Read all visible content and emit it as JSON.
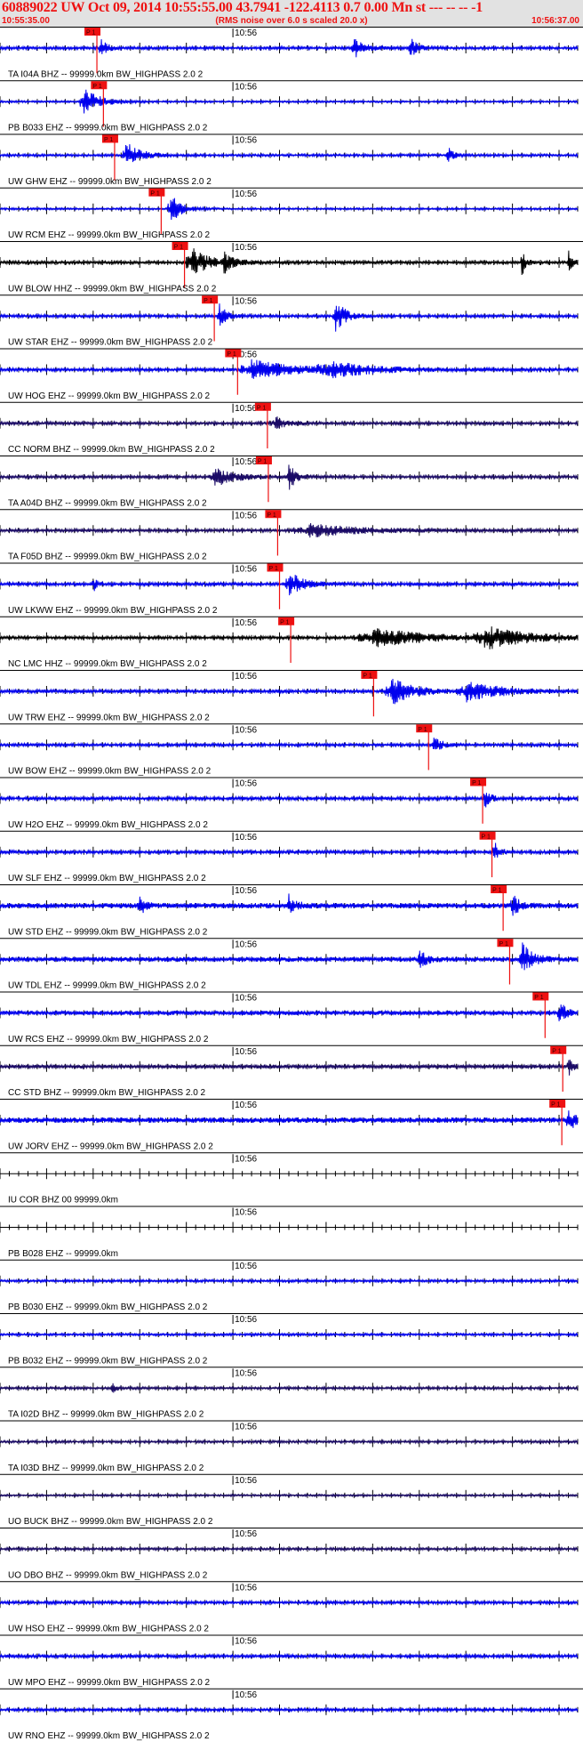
{
  "header": {
    "title": "60889022 UW Oct 09, 2014 10:55:55.00   43.7941 -122.4113  0.7 0.00 Mn st --- -- --   -1",
    "subtitle": "(RMS noise over 6.0 s scaled 20.0 x)",
    "start_time": "10:55:35.00",
    "end_time": "10:56:37.00"
  },
  "colors": {
    "header_bg": "#e2e2e2",
    "header_text": "#ee1111",
    "pick": "#ee1111",
    "blue": "#0000ee",
    "navy": "#1a0a66",
    "black": "#000000"
  },
  "chart_data": {
    "type": "seismogram",
    "x_range_seconds": [
      0,
      62
    ],
    "tick_label": "10:56",
    "pick_label": "P 1",
    "traces": [
      {
        "label": "TA I04A BHZ -- 99999.0km BW_HIGHPASS  2.0  2",
        "color": "blue",
        "noise": 0.3,
        "pick": 10.4,
        "bursts": [
          [
            10.8,
            8.0,
            0.8
          ],
          [
            38,
            6.0,
            1.5
          ],
          [
            44,
            7.0,
            1.0
          ]
        ]
      },
      {
        "label": "PB B033 EHZ -- 99999.0km BW_HIGHPASS  2.0  2",
        "color": "blue",
        "noise": 0.2,
        "pick": 11.1,
        "bursts": [
          [
            9,
            9.0,
            2.2
          ]
        ]
      },
      {
        "label": "UW GHW EHZ -- 99999.0km BW_HIGHPASS  2.0  2",
        "color": "blue",
        "noise": 0.25,
        "pick": 12.3,
        "bursts": [
          [
            13.5,
            9.0,
            2.0
          ],
          [
            48,
            6.0,
            0.8
          ]
        ]
      },
      {
        "label": "UW RCM EHZ -- 99999.0km BW_HIGHPASS  2.0  2",
        "color": "blue",
        "noise": 0.2,
        "pick": 17.3,
        "bursts": [
          [
            18.3,
            9.5,
            1.5
          ]
        ]
      },
      {
        "label": "UW BLOW HHZ -- 99999.0km BW_HIGHPASS  2.0  2",
        "color": "black",
        "noise": 0.3,
        "pick": 19.8,
        "bursts": [
          [
            20.5,
            9.5,
            2.5
          ],
          [
            24,
            6.0,
            1.5
          ],
          [
            56,
            10.0,
            0.5
          ],
          [
            61,
            8.0,
            0.5
          ]
        ]
      },
      {
        "label": "UW STAR EHZ -- 99999.0km BW_HIGHPASS  2.0  2",
        "color": "blue",
        "noise": 0.3,
        "pick": 23.0,
        "bursts": [
          [
            23.5,
            8.0,
            1.0
          ],
          [
            36,
            10.0,
            1.5
          ]
        ]
      },
      {
        "label": "UW HOG EHZ -- 99999.0km BW_HIGHPASS  2.0  2",
        "color": "blue",
        "noise": 0.35,
        "pick": 25.5,
        "bursts": [
          [
            27,
            6.0,
            6.0
          ],
          [
            35,
            5.0,
            6.0
          ]
        ]
      },
      {
        "label": "CC NORM BHZ -- 99999.0km BW_HIGHPASS  2.0  2",
        "color": "navy",
        "noise": 0.3,
        "pick": 28.7,
        "bursts": [
          [
            29.5,
            4.0,
            2.0
          ]
        ]
      },
      {
        "label": "TA A04D BHZ -- 99999.0km BW_HIGHPASS  2.0  2",
        "color": "navy",
        "noise": 0.3,
        "pick": 28.8,
        "bursts": [
          [
            23,
            6.0,
            3.0
          ],
          [
            31,
            9.0,
            1.0
          ]
        ]
      },
      {
        "label": "TA F05D BHZ -- 99999.0km BW_HIGHPASS  2.0  2",
        "color": "navy",
        "noise": 0.3,
        "pick": 29.8,
        "bursts": [
          [
            33,
            4.0,
            8.0
          ]
        ]
      },
      {
        "label": "UW LKWW EHZ -- 99999.0km BW_HIGHPASS  2.0  2",
        "color": "blue",
        "noise": 0.35,
        "pick": 30.0,
        "bursts": [
          [
            31,
            8.0,
            2.0
          ],
          [
            10,
            5.0,
            0.5
          ]
        ]
      },
      {
        "label": "NC LMC HHZ -- 99999.0km BW_HIGHPASS  2.0  2",
        "color": "black",
        "noise": 0.3,
        "pick": 31.2,
        "bursts": [
          [
            40,
            6.0,
            8.0
          ],
          [
            52,
            7.0,
            6.0
          ]
        ]
      },
      {
        "label": "UW TRW EHZ -- 99999.0km BW_HIGHPASS  2.0  2",
        "color": "blue",
        "noise": 0.35,
        "pick": 40.1,
        "bursts": [
          [
            42,
            9.5,
            3.0
          ],
          [
            50,
            6.0,
            5.0
          ]
        ]
      },
      {
        "label": "UW BOW EHZ -- 99999.0km BW_HIGHPASS  2.0  2",
        "color": "blue",
        "noise": 0.3,
        "pick": 46.0,
        "bursts": [
          [
            46.5,
            7.0,
            1.0
          ]
        ]
      },
      {
        "label": "UW H2O EHZ -- 99999.0km BW_HIGHPASS  2.0  2",
        "color": "blue",
        "noise": 0.35,
        "pick": 51.8,
        "bursts": [
          [
            52,
            7.0,
            0.8
          ]
        ]
      },
      {
        "label": "UW SLF EHZ -- 99999.0km BW_HIGHPASS  2.0  2",
        "color": "blue",
        "noise": 0.35,
        "pick": 52.8,
        "bursts": [
          [
            53,
            7.0,
            0.8
          ]
        ]
      },
      {
        "label": "UW STD EHZ -- 99999.0km BW_HIGHPASS  2.0  2",
        "color": "blue",
        "noise": 0.55,
        "pick": 54.0,
        "bursts": [
          [
            15,
            5.0,
            1.0
          ],
          [
            31,
            6.0,
            1.0
          ],
          [
            55,
            7.0,
            1.0
          ]
        ]
      },
      {
        "label": "UW TDL EHZ -- 99999.0km BW_HIGHPASS  2.0  2",
        "color": "blue",
        "noise": 0.5,
        "pick": 54.7,
        "bursts": [
          [
            56,
            10.0,
            1.5
          ],
          [
            45,
            6.0,
            1.0
          ]
        ]
      },
      {
        "label": "UW RCS EHZ -- 99999.0km BW_HIGHPASS  2.0  2",
        "color": "blue",
        "noise": 0.45,
        "pick": 58.5,
        "bursts": [
          [
            60,
            10.0,
            0.8
          ]
        ]
      },
      {
        "label": "CC STD BHZ -- 99999.0km BW_HIGHPASS  2.0  2",
        "color": "navy",
        "noise": 0.4,
        "pick": 60.4,
        "bursts": [
          [
            61,
            6.0,
            0.6
          ]
        ]
      },
      {
        "label": "UW JORV EHZ -- 99999.0km BW_HIGHPASS  2.0  2",
        "color": "blue",
        "noise": 0.55,
        "pick": 60.3,
        "bursts": [
          [
            61,
            7.0,
            1.0
          ]
        ]
      },
      {
        "label": "IU COR BHZ 00 99999.0km",
        "color": "blue",
        "noise": 0.0,
        "pick": null,
        "bursts": []
      },
      {
        "label": "PB B028 EHZ -- 99999.0km",
        "color": "blue",
        "noise": 0.0,
        "pick": null,
        "bursts": []
      },
      {
        "label": "PB B030 EHZ -- 99999.0km BW_HIGHPASS  2.0  2",
        "color": "blue",
        "noise": 0.25,
        "pick": null,
        "bursts": []
      },
      {
        "label": "PB B032 EHZ -- 99999.0km BW_HIGHPASS  2.0  2",
        "color": "blue",
        "noise": 0.25,
        "pick": null,
        "bursts": []
      },
      {
        "label": "TA I02D BHZ -- 99999.0km BW_HIGHPASS  2.0  2",
        "color": "navy",
        "noise": 0.25,
        "pick": null,
        "bursts": [
          [
            12,
            4.0,
            0.6
          ]
        ]
      },
      {
        "label": "TA I03D BHZ -- 99999.0km BW_HIGHPASS  2.0  2",
        "color": "navy",
        "noise": 0.25,
        "pick": null,
        "bursts": []
      },
      {
        "label": "UO BUCK BHZ -- 99999.0km BW_HIGHPASS  2.0  2",
        "color": "navy",
        "noise": 0.2,
        "pick": null,
        "bursts": []
      },
      {
        "label": "UO DBO BHZ -- 99999.0km BW_HIGHPASS  2.0  2",
        "color": "navy",
        "noise": 0.25,
        "pick": null,
        "bursts": []
      },
      {
        "label": "UW HSO EHZ -- 99999.0km BW_HIGHPASS  2.0  2",
        "color": "blue",
        "noise": 0.3,
        "pick": null,
        "bursts": []
      },
      {
        "label": "UW MPO EHZ -- 99999.0km BW_HIGHPASS  2.0  2",
        "color": "blue",
        "noise": 0.35,
        "pick": null,
        "bursts": []
      },
      {
        "label": "UW RNO EHZ -- 99999.0km BW_HIGHPASS  2.0  2",
        "color": "blue",
        "noise": 0.3,
        "pick": null,
        "bursts": []
      }
    ]
  }
}
